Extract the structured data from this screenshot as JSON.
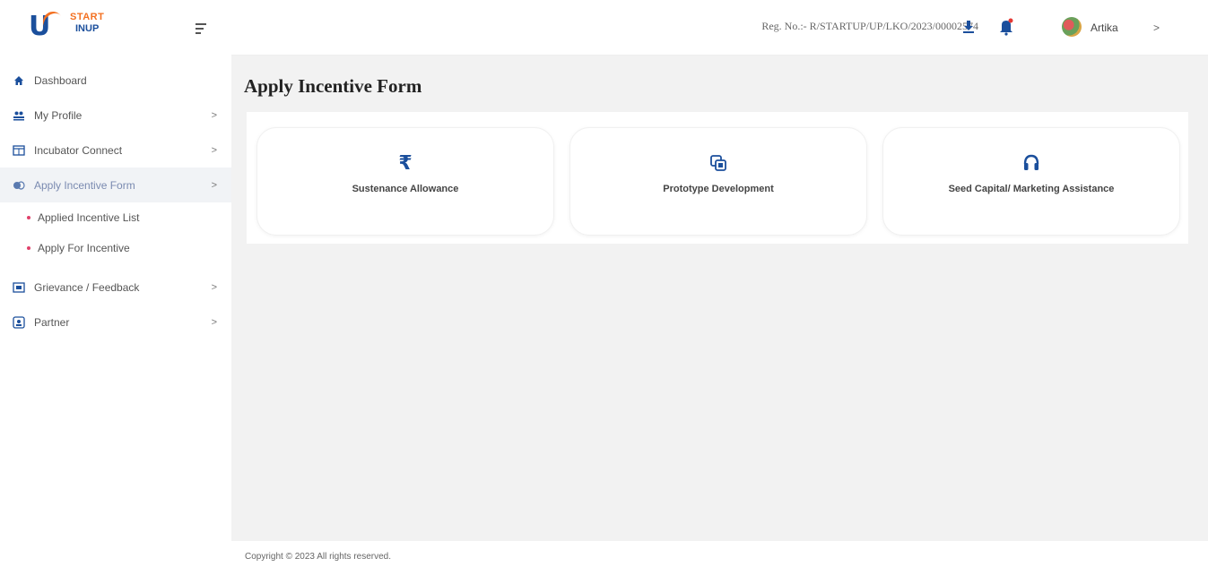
{
  "brand": {
    "logo_start": "START",
    "logo_inup": "INUP",
    "logo_letter": "U"
  },
  "header": {
    "reg_no": "Reg. No.:- R/STARTUP/UP/LKO/2023/00002574",
    "user_name": "Artika",
    "user_chevron": ">"
  },
  "sidebar": {
    "items": [
      {
        "label": "Dashboard",
        "icon": "home-icon"
      },
      {
        "label": "My Profile",
        "icon": "users-icon",
        "chevron": ">"
      },
      {
        "label": "Incubator Connect",
        "icon": "window-icon",
        "chevron": ">"
      },
      {
        "label": "Apply Incentive Form",
        "icon": "coins-icon",
        "chevron": ">"
      },
      {
        "label": "Grievance / Feedback",
        "icon": "feedback-icon",
        "chevron": ">"
      },
      {
        "label": "Partner",
        "icon": "partner-icon",
        "chevron": ">"
      }
    ],
    "subitems": [
      {
        "label": "Applied Incentive List"
      },
      {
        "label": "Apply For Incentive"
      }
    ]
  },
  "main": {
    "title": "Apply Incentive Form",
    "cards": [
      {
        "label": "Sustenance Allowance",
        "icon": "rupee-icon",
        "glyph": "₹"
      },
      {
        "label": "Prototype Development",
        "icon": "prototype-icon"
      },
      {
        "label": "Seed Capital/ Marketing Assistance",
        "icon": "headset-icon"
      }
    ]
  },
  "footer": {
    "text": "Copyright © 2023 All rights reserved."
  },
  "colors": {
    "brand_blue": "#1b4f9c",
    "brand_orange": "#f37021",
    "bullet_pink": "#e0406a",
    "bell_red": "#e53935"
  }
}
